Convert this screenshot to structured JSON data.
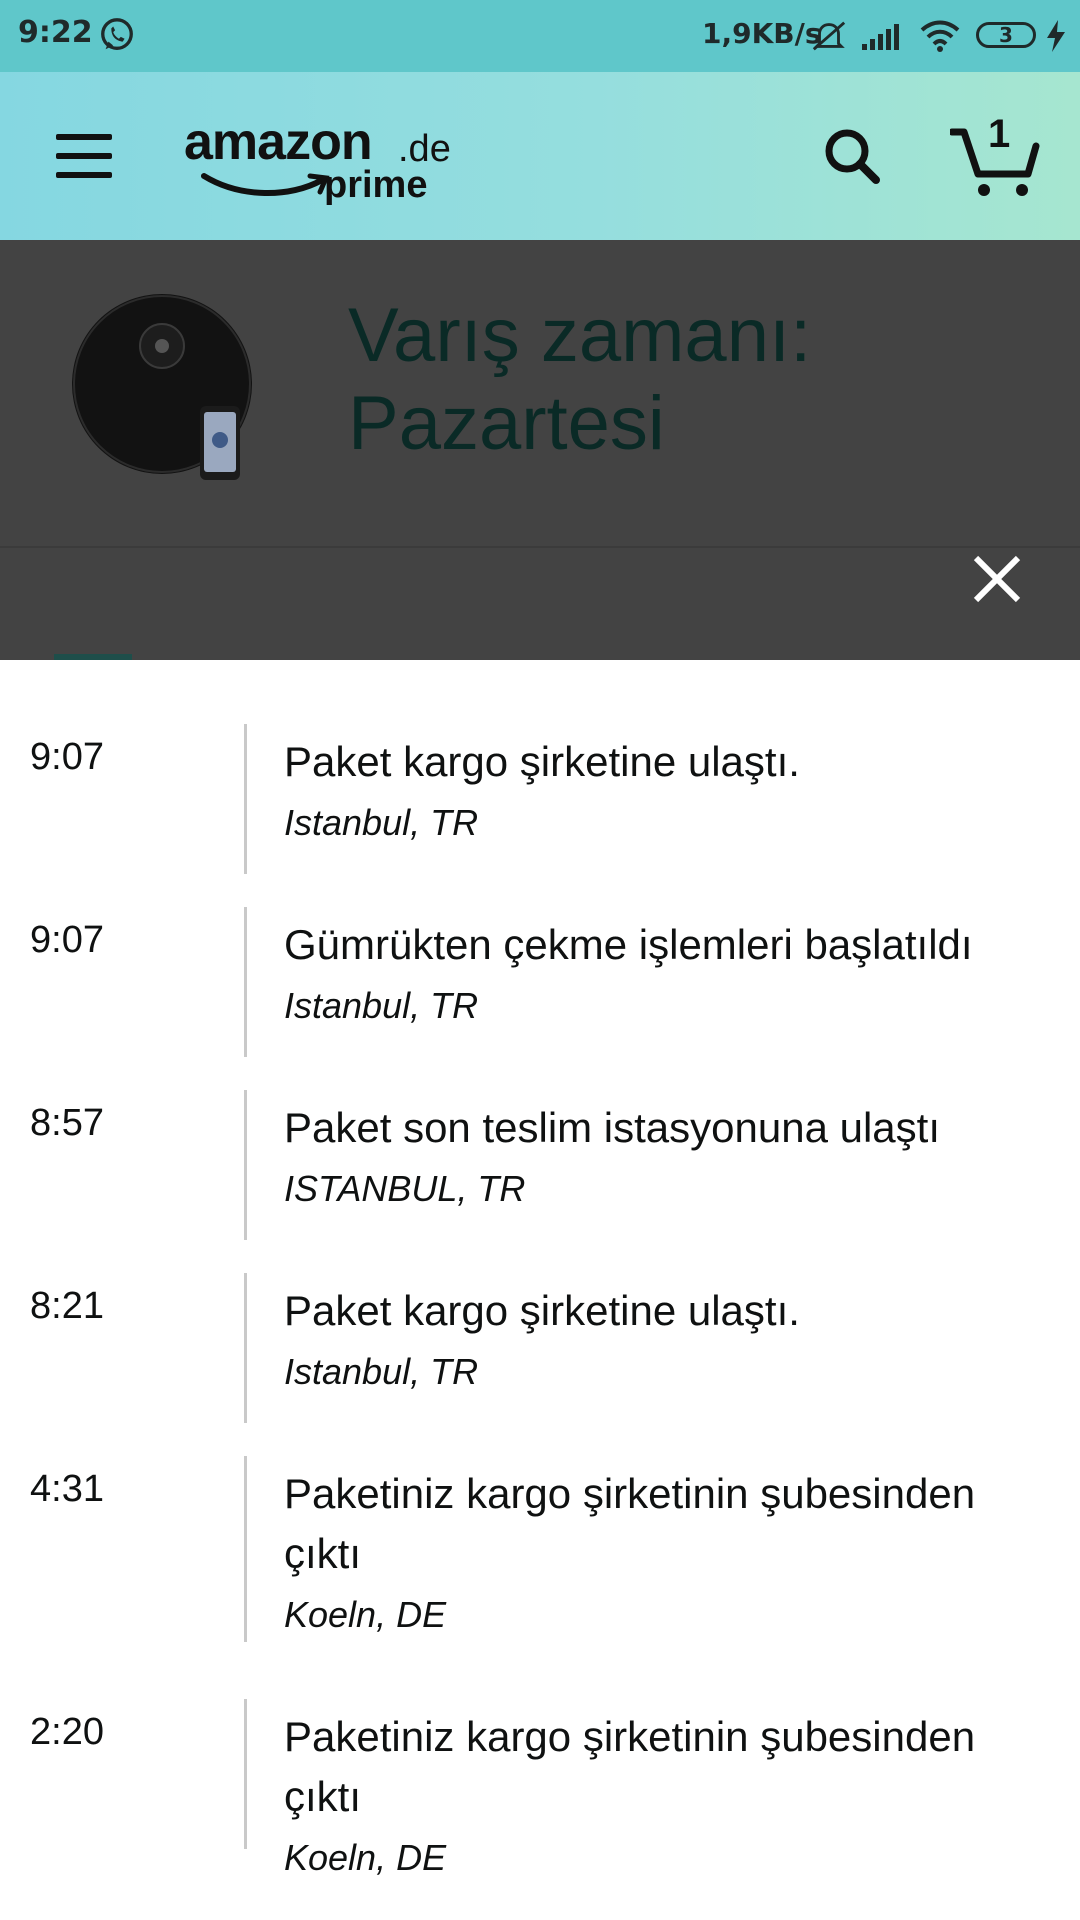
{
  "status_bar": {
    "time": "9:22",
    "network_speed": "1,9KB/s",
    "battery_level": "3",
    "icons": [
      "whatsapp-icon",
      "mute-icon",
      "signal-icon",
      "wifi-icon",
      "charging-bolt-icon"
    ]
  },
  "header": {
    "logo_main": "amazon",
    "logo_tld": ".de",
    "logo_sub": "prime",
    "cart_count": "1",
    "background_colors": [
      "#85d7e1",
      "#a6e6d0"
    ]
  },
  "tracking": {
    "arrival_title": "Varış zamanı: Pazartesi",
    "events": [
      {
        "time": "9:07",
        "title": "Paket kargo şirketine ulaştı.",
        "location": "Istanbul, TR"
      },
      {
        "time": "9:07",
        "title": "Gümrükten çekme işlemleri başlatıldı",
        "location": "Istanbul, TR"
      },
      {
        "time": "8:57",
        "title": "Paket son teslim istasyonuna ulaştı",
        "location": "ISTANBUL, TR"
      },
      {
        "time": "8:21",
        "title": "Paket kargo şirketine ulaştı.",
        "location": "Istanbul, TR"
      },
      {
        "time": "4:31",
        "title": "Paketiniz kargo şirketinin şubesinden çıktı",
        "location": "Koeln, DE"
      },
      {
        "time": "2:20",
        "title": "Paketiniz kargo şirketinin şubesinden çıktı",
        "location": "Koeln, DE"
      }
    ]
  }
}
